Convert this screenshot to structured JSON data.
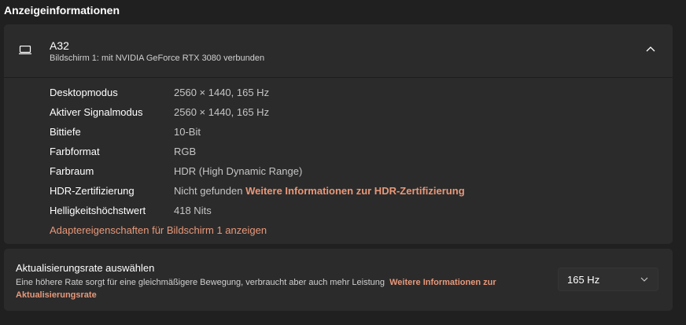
{
  "page": {
    "title": "Anzeigeinformationen"
  },
  "display": {
    "name": "A32",
    "subtitle": "Bildschirm 1: mit NVIDIA GeForce RTX 3080 verbunden",
    "icon": "laptop-icon",
    "collapse_icon": "chevron-up-icon",
    "rows": [
      {
        "label": "Desktopmodus",
        "value": "2560 × 1440, 165 Hz"
      },
      {
        "label": "Aktiver Signalmodus",
        "value": "2560 × 1440, 165 Hz"
      },
      {
        "label": "Bittiefe",
        "value": "10-Bit"
      },
      {
        "label": "Farbformat",
        "value": "RGB"
      },
      {
        "label": "Farbraum",
        "value": "HDR (High Dynamic Range)"
      },
      {
        "label": "HDR-Zertifizierung",
        "value": "Nicht gefunden",
        "link": "Weitere Informationen zur HDR-Zertifizierung"
      },
      {
        "label": "Helligkeitshöchstwert",
        "value": "418 Nits"
      }
    ],
    "adapter_link": "Adaptereigenschaften für Bildschirm 1 anzeigen"
  },
  "refresh": {
    "title": "Aktualisierungsrate auswählen",
    "description": "Eine höhere Rate sorgt für eine gleichmäßigere Bewegung, verbraucht aber auch mehr Leistung",
    "link": "Weitere Informationen zur Aktualisierungsrate",
    "selected": "165 Hz"
  },
  "colors": {
    "accent": "#e8987a",
    "background": "#202020",
    "card": "#2b2b2b"
  }
}
